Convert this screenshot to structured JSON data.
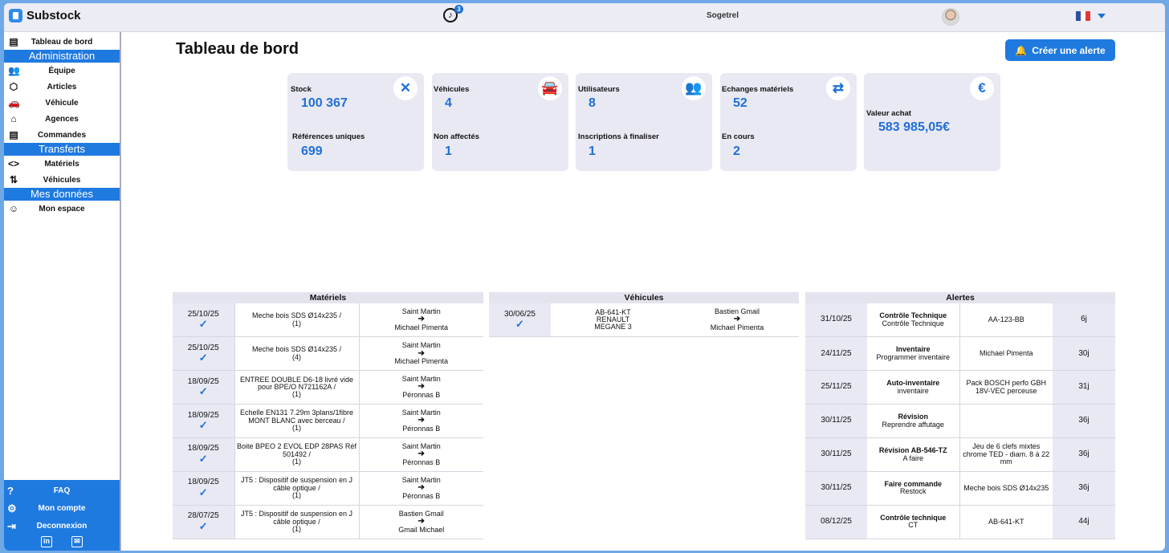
{
  "app": {
    "name": "Substock",
    "company": "Sogetrel",
    "notifications": "3"
  },
  "sidebar": {
    "top": {
      "label": "Tableau de bord"
    },
    "sections": [
      {
        "title": "Administration",
        "items": [
          {
            "label": "Équipe",
            "icon": "team-icon"
          },
          {
            "label": "Articles",
            "icon": "box-icon"
          },
          {
            "label": "Véhicule",
            "icon": "car-icon"
          },
          {
            "label": "Agences",
            "icon": "home-icon"
          },
          {
            "label": "Commandes",
            "icon": "clipboard-icon"
          }
        ]
      },
      {
        "title": "Transferts",
        "items": [
          {
            "label": "Matériels",
            "icon": "code-arrows-icon"
          },
          {
            "label": "Véhicules",
            "icon": "vehicle-transfer-icon"
          }
        ]
      },
      {
        "title": "Mes données",
        "items": [
          {
            "label": "Mon espace",
            "icon": "profile-icon"
          }
        ]
      }
    ],
    "bottom": {
      "faq": "FAQ",
      "account": "Mon compte",
      "logout": "Deconnexion"
    }
  },
  "page": {
    "title": "Tableau de bord",
    "alert_button": "Créer une alerte"
  },
  "cards": [
    {
      "label1": "Stock",
      "value1": "100 367",
      "label2": "Références uniques",
      "value2": "699",
      "icon": "tools-icon"
    },
    {
      "label1": "Véhicules",
      "value1": "4",
      "label2": "Non affectés",
      "value2": "1",
      "icon": "car-icon"
    },
    {
      "label1": "Utilisateurs",
      "value1": "8",
      "label2": "Inscriptions à finaliser",
      "value2": "1",
      "icon": "users-icon"
    },
    {
      "label1": "Echanges matériels",
      "value1": "52",
      "label2": "En cours",
      "value2": "2",
      "icon": "exchange-icon"
    },
    {
      "label1": "Valeur achat",
      "value1": "583 985,05€",
      "icon": "euro-icon"
    }
  ],
  "materiels": {
    "title": "Matériels",
    "rows": [
      {
        "date": "25/10/25",
        "item": "Meche bois SDS Ø14x235 /",
        "qty": "(1)",
        "from": "Saint Martin",
        "to": "Michael Pimenta"
      },
      {
        "date": "25/10/25",
        "item": "Meche bois SDS Ø14x235 /",
        "qty": "(4)",
        "from": "Saint Martin",
        "to": "Michael Pimenta"
      },
      {
        "date": "18/09/25",
        "item": "ENTREE DOUBLE D6-18 livré vide pour BPE/O N721162A /",
        "qty": "(1)",
        "from": "Saint Martin",
        "to": "Péronnas B"
      },
      {
        "date": "18/09/25",
        "item": "Echelle EN131 7.29m 3plans/1fibre MONT BLANC avec berceau /",
        "qty": "(1)",
        "from": "Saint Martin",
        "to": "Péronnas B"
      },
      {
        "date": "18/09/25",
        "item": "Boite BPEO 2 EVOL EDP 28PAS Réf 501492 /",
        "qty": "(1)",
        "from": "Saint Martin",
        "to": "Péronnas B"
      },
      {
        "date": "18/09/25",
        "item": "JT5 : Dispositif de suspension en J câble optique /",
        "qty": "(1)",
        "from": "Saint Martin",
        "to": "Péronnas B"
      },
      {
        "date": "28/07/25",
        "item": "JT5 : Dispositif de suspension en J câble optique /",
        "qty": "(1)",
        "from": "Bastien Gmail",
        "to": "Gmail Michael"
      }
    ]
  },
  "vehicules": {
    "title": "Véhicules",
    "rows": [
      {
        "date": "30/06/25",
        "plate": "AB-641-KT",
        "brand": "RENAULT",
        "model": "MEGANE 3",
        "from": "Bastien Gmail",
        "to": "Michael Pimenta"
      }
    ]
  },
  "alertes": {
    "title": "Alertes",
    "rows": [
      {
        "date": "31/10/25",
        "type": "Contrôle Technique",
        "sub": "Contrôle Technique",
        "target": "AA-123-BB",
        "delay": "6j"
      },
      {
        "date": "24/11/25",
        "type": "Inventaire",
        "sub": "Programmer inventaire",
        "target": "Michael Pimenta",
        "delay": "30j"
      },
      {
        "date": "25/11/25",
        "type": "Auto-inventaire",
        "sub": "inventaire",
        "target": "Pack BOSCH perfo GBH 18V-VEC perceuse",
        "delay": "31j"
      },
      {
        "date": "30/11/25",
        "type": "Révision",
        "sub": "Reprendre affutage",
        "target": "",
        "delay": "36j"
      },
      {
        "date": "30/11/25",
        "type": "Révision AB-546-TZ",
        "sub": "A faire",
        "target": "Jeu de 6 clefs mixtes chrome TED - diam. 8 à 22 mm",
        "delay": "36j"
      },
      {
        "date": "30/11/25",
        "type": "Faire commande",
        "sub": "Restock",
        "target": "Meche bois SDS Ø14x235",
        "delay": "36j"
      },
      {
        "date": "08/12/25",
        "type": "Contrôle technique",
        "sub": "CT",
        "target": "AB-641-KT",
        "delay": "44j"
      }
    ]
  },
  "colors": {
    "accent": "#1f7ae0",
    "card_bg": "#e9e9f4",
    "value": "#1f6fd6"
  }
}
